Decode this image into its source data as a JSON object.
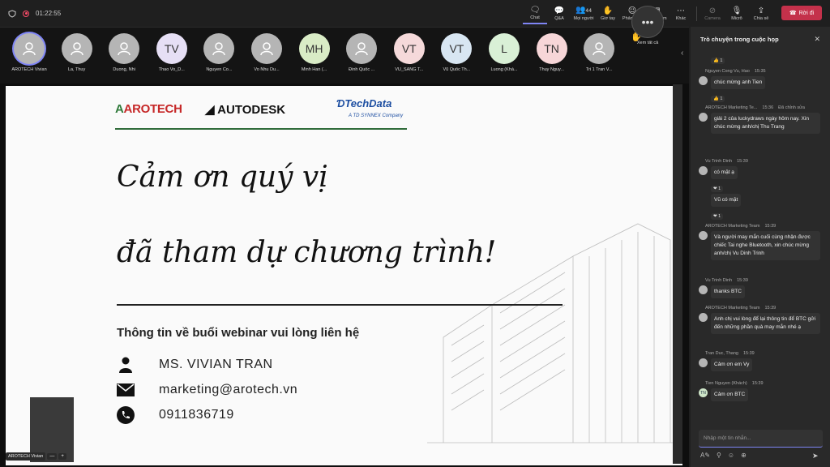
{
  "timer": "01:22:55",
  "toolbar": {
    "chat": "Chat",
    "qa": "Q&A",
    "people_count": "44",
    "people": "Mọi người",
    "raise": "Giơ tay",
    "react": "Phản ứng",
    "view": "Dạng xem",
    "more": "Khác",
    "camera": "Camera",
    "mic": "Micrô",
    "share": "Chia sẻ",
    "leave": "Rời đi"
  },
  "participants": [
    {
      "initials": "",
      "name": "AROTECH Vivian",
      "bg": "#b5b5b5"
    },
    {
      "initials": "",
      "name": "La, Thuy",
      "bg": "#b5b5b5"
    },
    {
      "initials": "",
      "name": "Duong, Nhi",
      "bg": "#b5b5b5"
    },
    {
      "initials": "TV",
      "name": "Thao Vo_D...",
      "bg": "#e6dff5"
    },
    {
      "initials": "",
      "name": "Nguyen Co...",
      "bg": "#b5b5b5"
    },
    {
      "initials": "",
      "name": "Vo Nhu Du...",
      "bg": "#b5b5b5"
    },
    {
      "initials": "MH",
      "name": "Minh Han (...",
      "bg": "#d9ecc6"
    },
    {
      "initials": "",
      "name": "Đinh Quốc ...",
      "bg": "#b5b5b5"
    },
    {
      "initials": "VT",
      "name": "VŨ_SANG T...",
      "bg": "#f5d9da"
    },
    {
      "initials": "VT",
      "name": "Vũ Quốc Th...",
      "bg": "#d8e6f2"
    },
    {
      "initials": "L",
      "name": "Luong (Khá...",
      "bg": "#d9f0d6"
    },
    {
      "initials": "TN",
      "name": "Thuy Nguy...",
      "bg": "#f7d6d8"
    },
    {
      "initials": "",
      "name": "Tri 1 Tran V...",
      "bg": "#b5b5b5"
    }
  ],
  "see_all": "Xem tất cả",
  "slide": {
    "logo_arotech": "AROTECH",
    "logo_autodesk": "AUTODESK",
    "logo_techdata": "TechData",
    "logo_techdata_sub": "A TD SYNNEX Company",
    "line1": "Cảm ơn quý vị",
    "line2": "đã tham dự chương trình!",
    "info": "Thông tin về buổi webinar vui lòng liên hệ",
    "name": "MS. VIVIAN TRAN",
    "email": "marketing@arotech.vn",
    "phone": "0911836719"
  },
  "self_view": {
    "name": "AROTECH Vivian"
  },
  "chat": {
    "title": "Trò chuyện trong cuộc họp",
    "input_placeholder": "Nhập một tin nhắn...",
    "messages": [
      {
        "author": "",
        "time": "",
        "text": "",
        "reaction": "👍 1"
      },
      {
        "author": "Nguyen Cong Vu, Hao",
        "time": "15:35",
        "text": "chúc mừng anh Tien",
        "reaction": "👍 1"
      },
      {
        "author": "AROTECH Marketing Te...",
        "time": "15:36",
        "edited": "Đã chỉnh sửa",
        "text": "giải 2 của luckydraws ngày hôm nay. Xin chúc mừng anh/chị Thu Trang"
      },
      {
        "author": "Vu Trinh Dinh",
        "time": "15:39",
        "text": "có mặt ạ",
        "reaction": "❤ 1"
      },
      {
        "text": "Vũ có mặt",
        "reaction": "❤ 1"
      },
      {
        "author": "AROTECH Marketing Team",
        "time": "15:39",
        "text": "Và người may mắn cuối cùng nhận được chiếc Tai nghe Bluetooth, xin chúc mừng anh/chị Vu Dinh Trinh"
      },
      {
        "author": "Vu Trinh Dinh",
        "time": "15:39",
        "text": "thanks BTC"
      },
      {
        "author": "AROTECH Marketing Team",
        "time": "15:39",
        "text": "Anh chị vui lòng để lại thông tin để BTC gửi đến những phần quà may mắn nhé ạ"
      },
      {
        "author": "Tran Duc, Thang",
        "time": "15:39",
        "text": "Cảm ơn em Vy"
      },
      {
        "author": "Tien Nguyen (Khách)",
        "time": "15:39",
        "initials": "TN",
        "text": "Cảm ơn BTC"
      }
    ]
  }
}
